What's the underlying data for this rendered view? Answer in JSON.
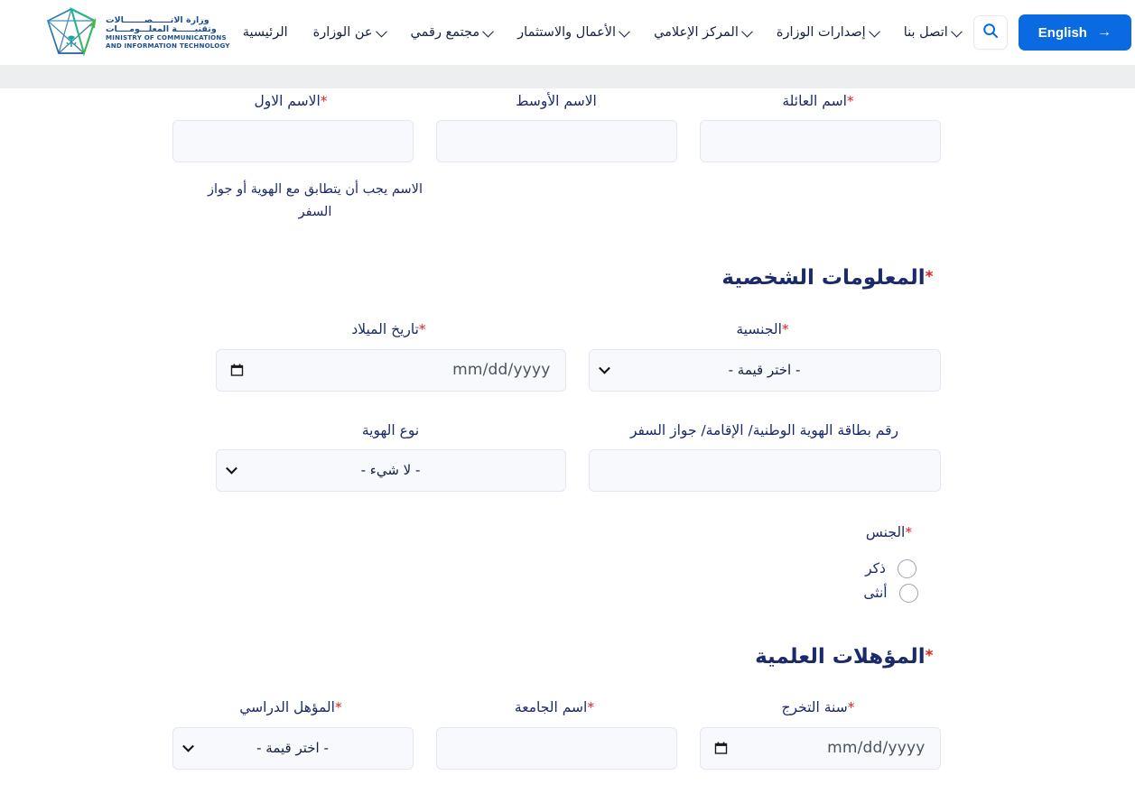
{
  "header": {
    "logo": {
      "arabic_line1": "وزارة الاتــــــصـــــــالات",
      "arabic_line2": "وتقنيــــــة المعلـــومــــات",
      "english_line1": "MINISTRY OF COMMUNICATIONS",
      "english_line2": "AND INFORMATION TECHNOLOGY",
      "icon": "mcit-logo-icon"
    },
    "nav": [
      {
        "label": "الرئيسية",
        "has_dropdown": false
      },
      {
        "label": "عن الوزارة",
        "has_dropdown": true
      },
      {
        "label": "مجتمع رقمي",
        "has_dropdown": true
      },
      {
        "label": "الأعمال والاستثمار",
        "has_dropdown": true
      },
      {
        "label": "المركز الإعلامي",
        "has_dropdown": true
      },
      {
        "label": "إصدارات الوزارة",
        "has_dropdown": true
      },
      {
        "label": "اتصل بنا",
        "has_dropdown": true
      }
    ],
    "search_icon": "search-icon",
    "language_button": {
      "label": "English",
      "arrow": "→"
    }
  },
  "form": {
    "name_row": {
      "first_name": {
        "label": "الاسم الاول",
        "required": true,
        "value": "",
        "placeholder": ""
      },
      "middle_name": {
        "label": "الاسم الأوسط",
        "required": false,
        "value": "",
        "placeholder": ""
      },
      "family_name": {
        "label": "اسم العائلة",
        "required": true,
        "value": "",
        "placeholder": ""
      },
      "help_text": "الاسم يجب أن يتطابق مع الهوية أو جواز السفر"
    },
    "personal_section": {
      "title": "المعلومات الشخصية",
      "required": true,
      "birth_date": {
        "label": "تاريخ الميلاد",
        "required": true,
        "value": "mm/dd/yyyy",
        "icon": "calendar-icon"
      },
      "nationality": {
        "label": "الجنسية",
        "required": true,
        "value": "- اختر قيمة -"
      },
      "id_type": {
        "label": "نوع الهوية",
        "required": false,
        "value": "- لا شيء -"
      },
      "id_number": {
        "label": "رقم بطاقة الهوية الوطنية/ الإقامة/ جواز السفر",
        "required": false,
        "value": "",
        "placeholder": ""
      },
      "gender": {
        "label": "الجنس",
        "required": true,
        "options": [
          {
            "label": "ذكر",
            "selected": false
          },
          {
            "label": "أنثى",
            "selected": false
          }
        ]
      }
    },
    "education_section": {
      "title": "المؤهلات العلمية",
      "required": true,
      "degree": {
        "label": "المؤهل الدراسي",
        "required": true,
        "value": "- اختر قيمة -"
      },
      "university": {
        "label": "اسم الجامعة",
        "required": true,
        "value": "",
        "placeholder": ""
      },
      "graduation_year": {
        "label": "سنة التخرج",
        "required": true,
        "value": "mm/dd/yyyy",
        "icon": "calendar-icon"
      }
    }
  },
  "colors": {
    "accent_blue": "#0a6ae1",
    "label_navy": "#1b2a6b",
    "required_red": "#e02020",
    "input_bg": "#f8f9fc",
    "input_border": "#e4e7f1",
    "band_gray": "#eceef0",
    "logo_blue": "#1d4f91"
  }
}
